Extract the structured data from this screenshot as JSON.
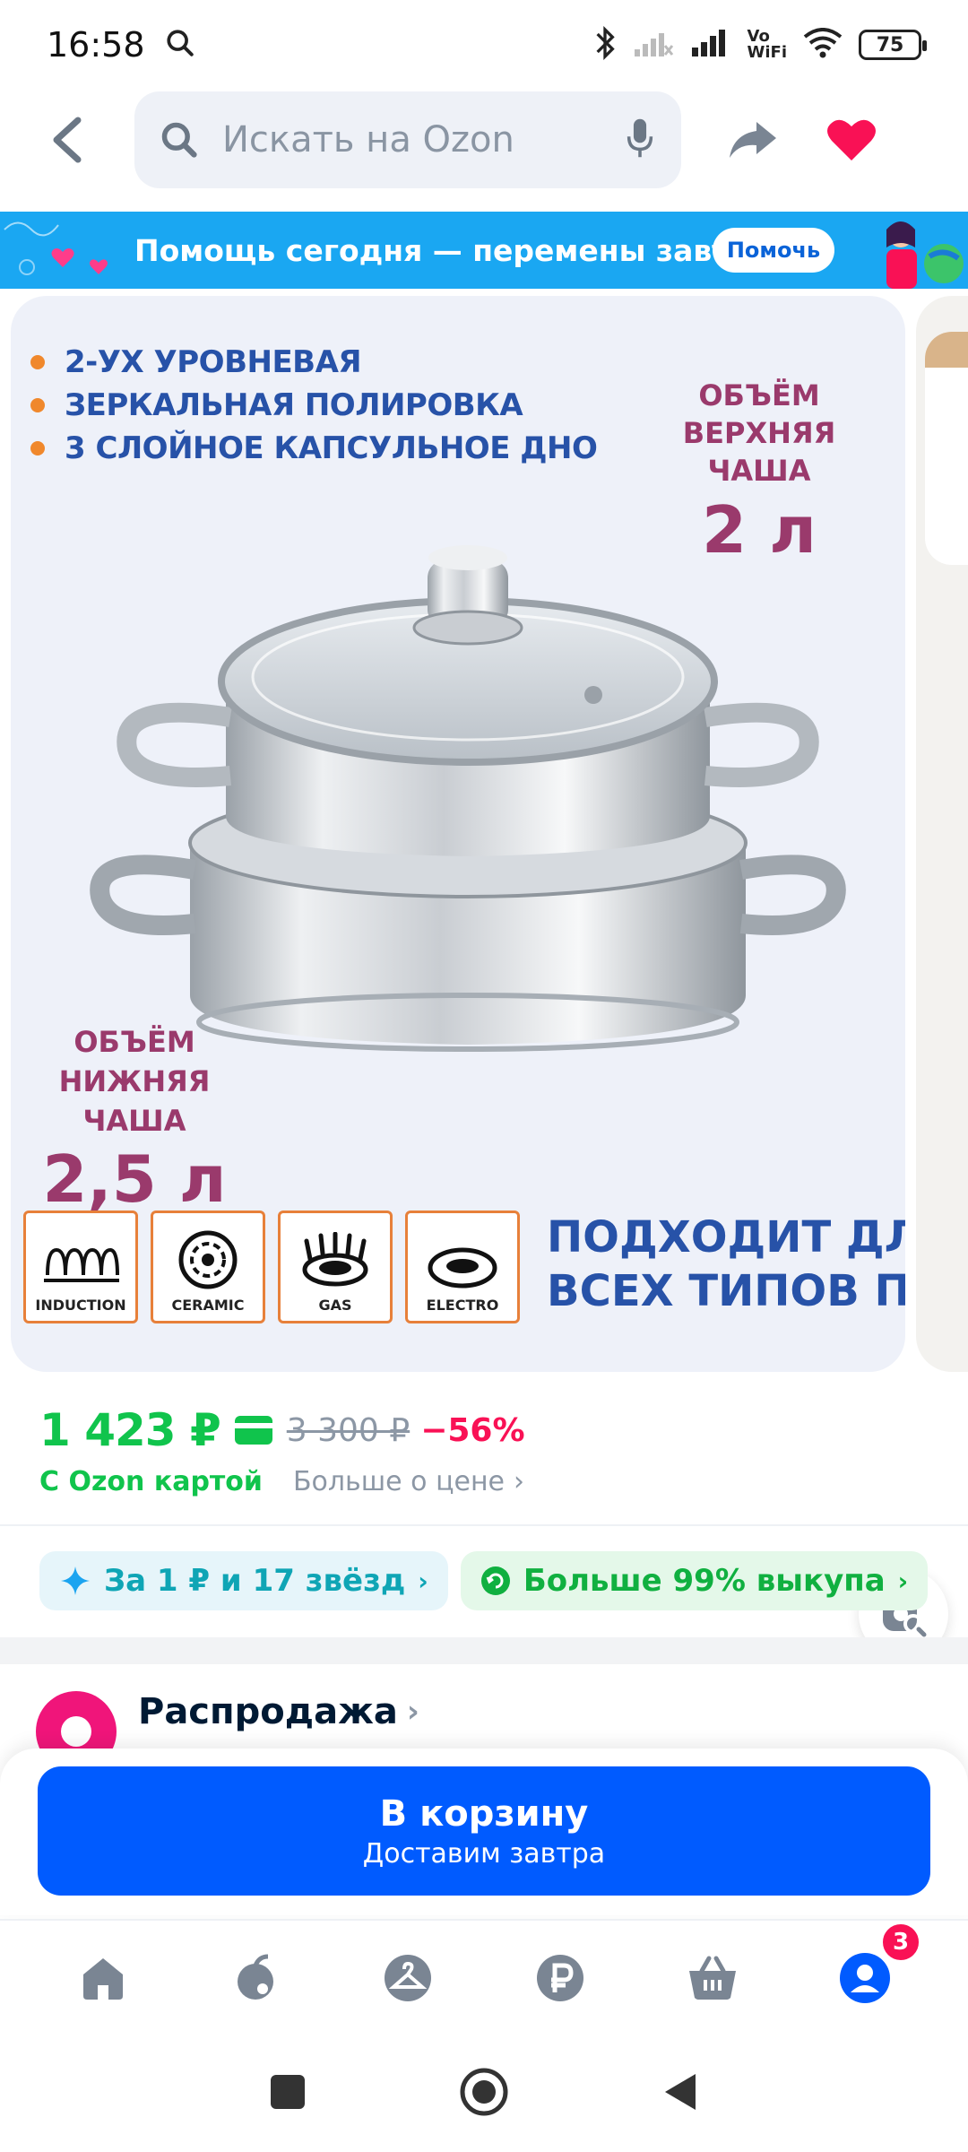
{
  "status_bar": {
    "time": "16:58",
    "vowifi_top": "Vo",
    "vowifi_bottom": "WiFi",
    "battery": "75"
  },
  "header": {
    "search_placeholder": "Искать на Ozon"
  },
  "banner": {
    "text": "Помощь сегодня — перемены завтра",
    "button": "Помочь",
    "bg_color": "#1aa7f2"
  },
  "product_image": {
    "features": [
      "2-УХ УРОВНЕВАЯ",
      "ЗЕРКАЛЬНАЯ ПОЛИРОВКА",
      "3 СЛОЙНОЕ КАПСУЛЬНОЕ ДНО"
    ],
    "volume_top": {
      "line1": "ОБЪЁМ",
      "line2": "ВЕРХНЯЯ ЧАША",
      "value": "2 л"
    },
    "volume_bottom": {
      "line1": "ОБЪЁМ",
      "line2": "НИЖНЯЯ ЧАША",
      "value": "2,5 л"
    },
    "stoves": [
      {
        "label": "INDUCTION",
        "icon": "induction-coil-icon"
      },
      {
        "label": "CERAMIC",
        "icon": "ceramic-hob-icon"
      },
      {
        "label": "GAS",
        "icon": "gas-burner-icon"
      },
      {
        "label": "ELECTRO",
        "icon": "electric-plate-icon"
      }
    ],
    "suits_line1": "ПОДХОДИТ ДЛЯ",
    "suits_line2": "ВСЕХ ТИПОВ ПЛИТ"
  },
  "price": {
    "current": "1 423 ₽",
    "old": "3 300 ₽",
    "discount": "−56%",
    "ozon_card": "С Ozon картой",
    "more": "Больше о цене",
    "accent_color": "#10c44c"
  },
  "chips": {
    "stars": "За 1 ₽ и 17 звёзд",
    "buyout": "Больше 99% выкупа"
  },
  "sale": {
    "title": "Распродажа"
  },
  "cart": {
    "button": "В корзину",
    "sub": "Доставим завтра",
    "color": "#005bff"
  },
  "bottom_nav": {
    "items": [
      "home-icon",
      "fresh-icon",
      "fashion-icon",
      "finance-icon",
      "cart-icon",
      "profile-icon"
    ],
    "profile_badge": "3"
  }
}
